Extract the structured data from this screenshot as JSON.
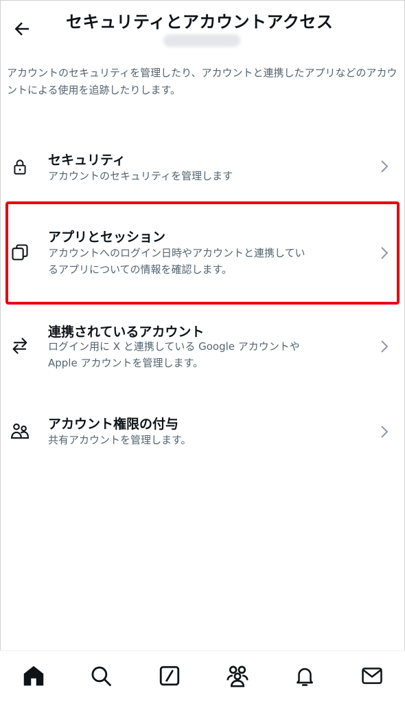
{
  "header": {
    "title": "セキュリティとアカウントアクセス",
    "back_icon": "arrow-left-icon"
  },
  "intro_text": "アカウントのセキュリティを管理したり、アカウントと連携したアプリなどのアカウントによる使用を追跡したりします。",
  "items": [
    {
      "title": "セキュリティ",
      "desc_lines": [
        "アカウントのセキュリティを管理します"
      ],
      "icon": "lock-icon"
    },
    {
      "title": "アプリとセッション",
      "desc_lines": [
        "アカウントへのログイン日時やアカウントと連携してい",
        "るアプリについての情報を確認します。"
      ],
      "icon": "copy-icon"
    },
    {
      "title": "連携されているアカウント",
      "desc_lines": [
        "ログイン用に X と連携している Google アカウントや",
        "Apple アカウントを管理します。"
      ],
      "icon": "swap-arrows-icon"
    },
    {
      "title": "アカウント権限の付与",
      "desc_lines": [
        "共有アカウントを管理します。"
      ],
      "icon": "people-icon"
    }
  ],
  "highlight_color": "#e60012",
  "text_color": "#0f1419",
  "secondary_color": "#536471",
  "tabbar": {
    "tabs": [
      {
        "icon": "home-icon"
      },
      {
        "icon": "search-icon"
      },
      {
        "icon": "compose-icon"
      },
      {
        "icon": "communities-icon"
      },
      {
        "icon": "bell-icon"
      },
      {
        "icon": "mail-icon"
      }
    ]
  }
}
